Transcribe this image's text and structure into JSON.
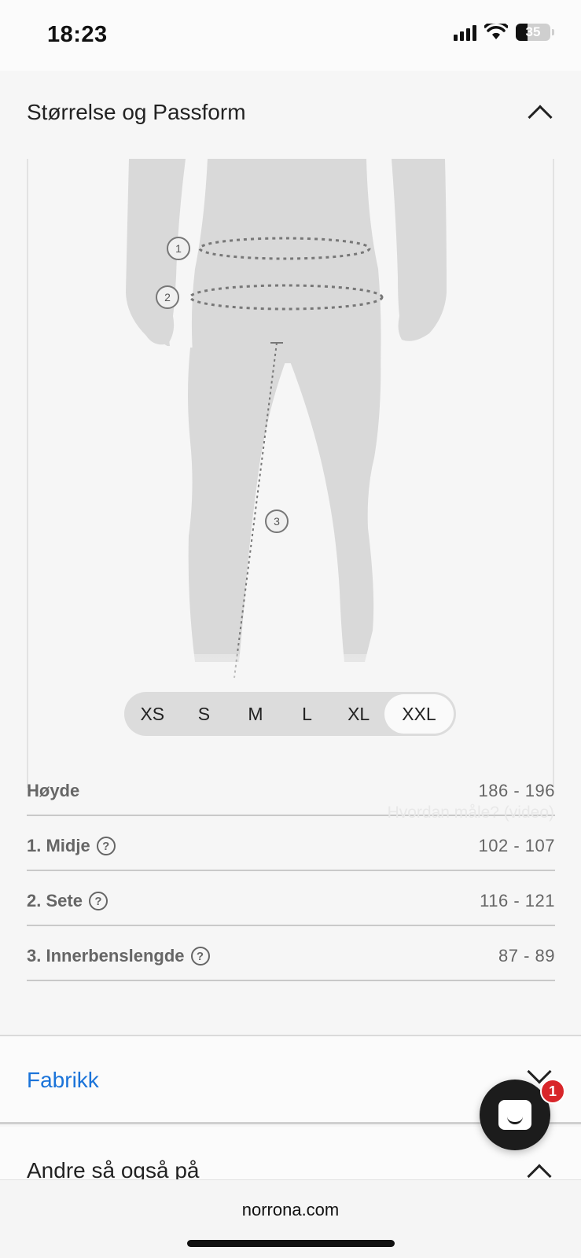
{
  "status_bar": {
    "time": "18:23",
    "battery": "35"
  },
  "size_fit": {
    "title": "Størrelse og Passform",
    "markers": [
      "1",
      "2",
      "3"
    ],
    "sizes": [
      "XS",
      "S",
      "M",
      "L",
      "XL",
      "XXL"
    ],
    "selected_size": "XXL",
    "how_to_measure": "Hvordan måle? (video)",
    "rows": [
      {
        "label": "Høyde",
        "value": "186 - 196",
        "help": false
      },
      {
        "label": "1. Midje",
        "value": "102 - 107",
        "help": true
      },
      {
        "label": "2. Sete",
        "value": "116 - 121",
        "help": true
      },
      {
        "label": "3. Innerbenslengde",
        "value": "87 - 89",
        "help": true
      }
    ],
    "help_glyph": "?"
  },
  "fabric": {
    "title": "Fabrikk"
  },
  "others": {
    "title": "Andre så også på"
  },
  "browser": {
    "url": "norrona.com"
  },
  "chat": {
    "badge_count": "1"
  },
  "colors": {
    "accent": "#1a73d9",
    "badge": "#d8262a",
    "figure": "#d9d9d9"
  }
}
